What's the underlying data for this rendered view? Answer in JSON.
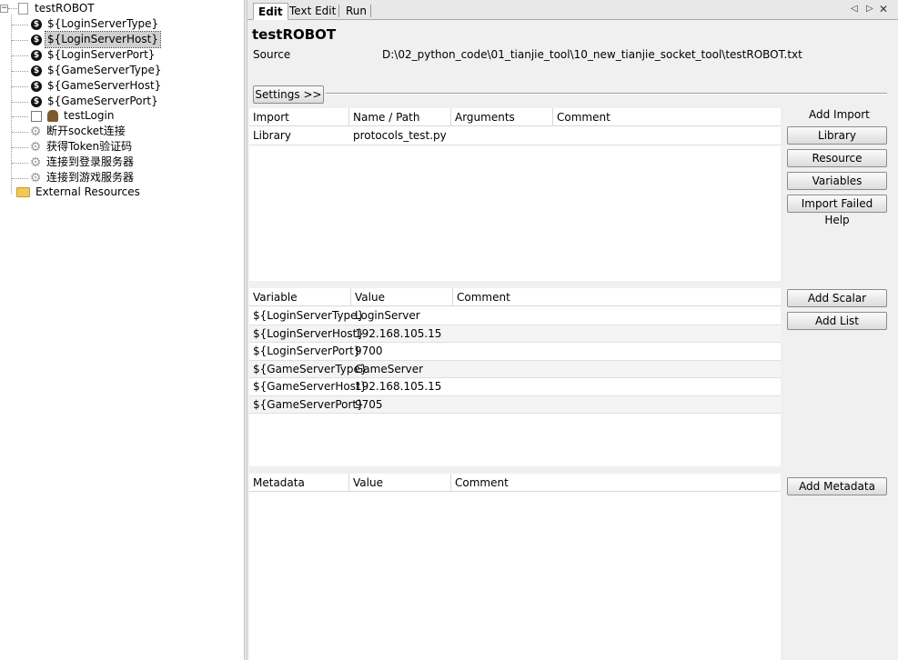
{
  "tree": {
    "root_label": "testROBOT",
    "variables": [
      "${LoginServerType}",
      "${LoginServerHost}",
      "${LoginServerPort}",
      "${GameServerType}",
      "${GameServerHost}",
      "${GameServerPort}"
    ],
    "selected_index": 1,
    "test_case": "testLogin",
    "keywords": [
      "断开socket连接",
      "获得Token验证码",
      "连接到登录服务器",
      "连接到游戏服务器"
    ],
    "external_resources": "External Resources"
  },
  "tabs": [
    "Edit",
    "Text Edit",
    "Run"
  ],
  "editor": {
    "title": "testROBOT",
    "source_label": "Source",
    "source_path": "D:\\02_python_code\\01_tianjie_tool\\10_new_tianjie_socket_tool\\testROBOT.txt",
    "settings_button": "Settings >>"
  },
  "imports": {
    "columns": [
      "Import",
      "Name / Path",
      "Arguments",
      "Comment"
    ],
    "rows": [
      {
        "type": "Library",
        "name": "protocols_test.py",
        "args": "",
        "comment": ""
      }
    ],
    "side_label": "Add Import",
    "buttons": [
      "Library",
      "Resource",
      "Variables",
      "Import Failed Help"
    ]
  },
  "variables": {
    "columns": [
      "Variable",
      "Value",
      "Comment"
    ],
    "rows": [
      {
        "name": "${LoginServerType}",
        "value": "LoginServer",
        "comment": ""
      },
      {
        "name": "${LoginServerHost}",
        "value": "192.168.105.15",
        "comment": ""
      },
      {
        "name": "${LoginServerPort}",
        "value": "9700",
        "comment": ""
      },
      {
        "name": "${GameServerType}",
        "value": "GameServer",
        "comment": ""
      },
      {
        "name": "${GameServerHost}",
        "value": "192.168.105.15",
        "comment": ""
      },
      {
        "name": "${GameServerPort}",
        "value": "9705",
        "comment": ""
      }
    ],
    "buttons": [
      "Add Scalar",
      "Add List"
    ]
  },
  "metadata": {
    "columns": [
      "Metadata",
      "Value",
      "Comment"
    ],
    "rows": [],
    "button": "Add Metadata"
  }
}
